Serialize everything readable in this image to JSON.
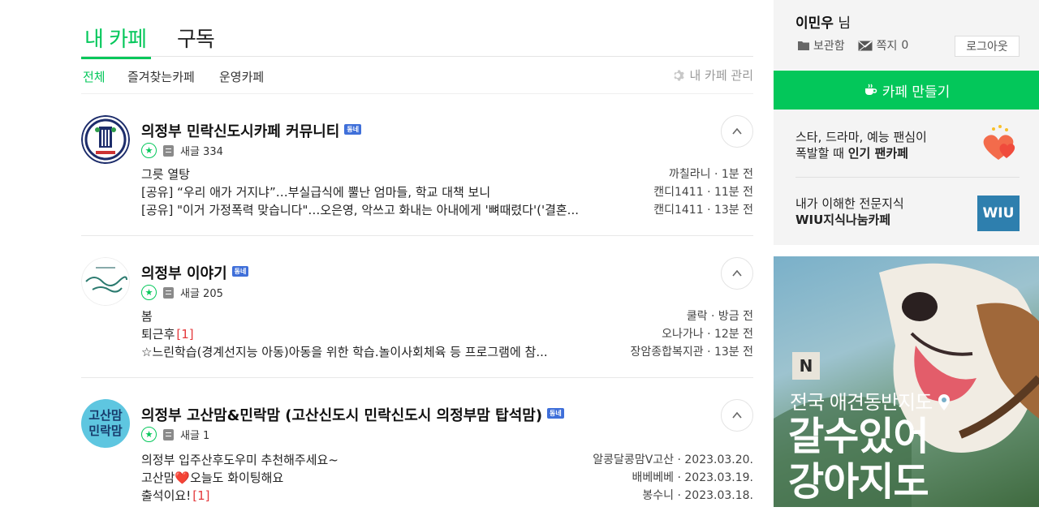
{
  "tabs": {
    "my_cafe": "내 카페",
    "subscribe": "구독"
  },
  "subtabs": [
    "전체",
    "즐겨찾는카페",
    "운영카페"
  ],
  "manage_label": "내 카페 관리",
  "cafes": [
    {
      "name": "의정부 민락신도시카페 커뮤니티",
      "badge": "동네",
      "new_posts": "새글 334",
      "posts": [
        {
          "title": "그릇 열탕",
          "count": "",
          "info": "까칠라니 · 1분 전"
        },
        {
          "title": "[공유] “우리 애가 거지냐”…부실급식에 뿔난 엄마들, 학교 대책 보니",
          "count": "",
          "info": "캔디1411 · 11분 전"
        },
        {
          "title": "[공유] \"이거 가정폭력 맞습니다\"…오은영, 악쓰고 화내는 아내에게 '뼈때렸다'('결혼...",
          "count": "",
          "info": "캔디1411 · 13분 전"
        }
      ]
    },
    {
      "name": "의정부 이야기",
      "badge": "동네",
      "new_posts": "새글 205",
      "posts": [
        {
          "title": "봄",
          "count": "",
          "info": "쿨락 · 방금 전"
        },
        {
          "title": "퇴근후",
          "count": "[1]",
          "info": "오나가나 · 12분 전"
        },
        {
          "title": "☆느린학습(경계선지능 아동)아동을 위한 학습.놀이사회체육 등 프로그램에 참...",
          "count": "",
          "info": "장암종합복지관 · 13분 전"
        }
      ]
    },
    {
      "name": "의정부 고산맘&민락맘 (고산신도시 민락신도시 의정부맘 탑석맘)",
      "badge": "동네",
      "new_posts": "새글 1",
      "thumb_text": "고산맘\n민락맘",
      "posts": [
        {
          "title": "의정부 입주산후도우미 추천해주세요~",
          "count": "",
          "info": "알콩달콩맘V고산 · 2023.03.20."
        },
        {
          "title": "고산맘❤️오늘도 화이팅해요",
          "count": "",
          "info": "배베베베 · 2023.03.19."
        },
        {
          "title": "출석이요!",
          "count": "[1]",
          "info": "봉수니 · 2023.03.18."
        }
      ]
    }
  ],
  "user": {
    "name": "이민우",
    "suffix": "님",
    "storage": "보관함",
    "notes": "쪽지",
    "notes_count": "0",
    "logout": "로그아웃"
  },
  "create_cafe": "카페 만들기",
  "promos": [
    {
      "line1": "스타, 드라마, 예능 팬심이",
      "line2_prefix": "폭발할 때 ",
      "line2_bold": "인기 팬카페"
    },
    {
      "line1": "내가 이해한 전문지식",
      "line2_prefix": "",
      "line2_bold": "WIU지식나눔카페",
      "logo": "WIU"
    }
  ],
  "ad": {
    "logo": "N",
    "line1": "전국 애견동반지도",
    "big1": "갈수있어",
    "big2": "강아지도"
  },
  "colors": {
    "accent": "#03c75a",
    "badge": "#3f6fd9",
    "comment_count": "#e4393c"
  }
}
